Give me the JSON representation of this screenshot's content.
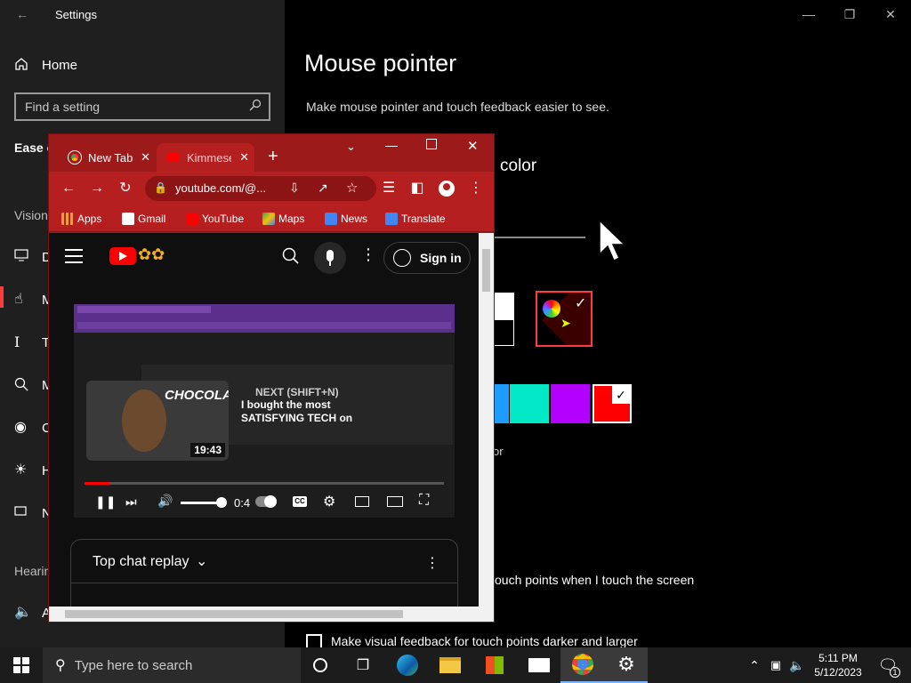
{
  "settings": {
    "window_title": "Settings",
    "home_label": "Home",
    "search_placeholder": "Find a setting",
    "section_partial": "Ease c",
    "vision_label": "Vision",
    "hearing_label": "Hearin",
    "side_items": [
      "D",
      "M",
      "T",
      "M",
      "C",
      "H",
      "N",
      "A"
    ],
    "page_title": "Mouse pointer",
    "page_desc": "Make mouse pointer and touch feedback easier to see.",
    "subheading_partial": "color",
    "custom_color_partial": "or",
    "touch_option_partial": "ouch points when I touch the screen",
    "touch_checkbox_label": "Make visual feedback for touch points darker and larger",
    "suggested_colors": [
      "#1e9bff",
      "#00e8c6",
      "#b400ff",
      "#ff0000"
    ],
    "accent": "#ff0000"
  },
  "chrome": {
    "tabs": [
      {
        "label": "New Tab",
        "icon": "chrome-icon"
      },
      {
        "label": "Kimmese",
        "icon": "youtube-icon"
      }
    ],
    "address": "youtube.com/@...",
    "bookmarks": [
      {
        "label": "Apps",
        "icon": "apps-grid-icon",
        "color": "#e8a13a"
      },
      {
        "label": "Gmail",
        "icon": "gmail-icon",
        "color": "#ffffff"
      },
      {
        "label": "YouTube",
        "icon": "youtube-icon",
        "color": "#ff0000"
      },
      {
        "label": "Maps",
        "icon": "maps-icon",
        "color": "#34a853"
      },
      {
        "label": "News",
        "icon": "news-icon",
        "color": "#4285f4"
      },
      {
        "label": "Translate",
        "icon": "translate-icon",
        "color": "#4285f4"
      }
    ],
    "frame_color": "#9d1a1a"
  },
  "youtube": {
    "sign_in_label": "Sign in",
    "next_label": "NEXT (SHIFT+N)",
    "next_title": "I bought the most SATISFYING TECH on",
    "thumb_duration": "19:43",
    "thumb_text": "CHOCOLATE",
    "time_partial": "0:4",
    "chat_label": "Top chat replay"
  },
  "taskbar": {
    "search_placeholder": "Type here to search",
    "time": "5:11 PM",
    "date": "5/12/2023",
    "notification_count": "1"
  }
}
